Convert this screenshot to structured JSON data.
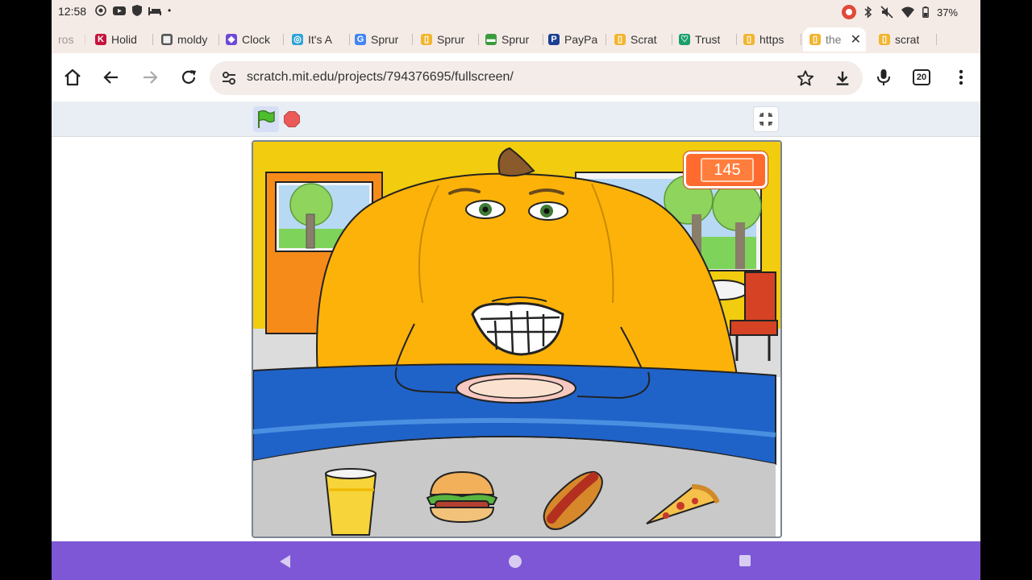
{
  "status": {
    "time": "12:58",
    "battery": "37%"
  },
  "tabs": [
    {
      "label": "ros",
      "fav_color": "#ffffff",
      "fav_glyph": ""
    },
    {
      "label": "Holid",
      "fav_color": "#c4143c",
      "fav_glyph": "K"
    },
    {
      "label": "moldy",
      "fav_color": "#555555",
      "fav_glyph": "▦"
    },
    {
      "label": "Clock",
      "fav_color": "#6c4ad8",
      "fav_glyph": "◆"
    },
    {
      "label": "It's A",
      "fav_color": "#2fa4d8",
      "fav_glyph": "◎"
    },
    {
      "label": "Sprur",
      "fav_color": "#4285f4",
      "fav_glyph": "G"
    },
    {
      "label": "Sprur",
      "fav_color": "#f2b530",
      "fav_glyph": "▯"
    },
    {
      "label": "Sprur",
      "fav_color": "#3a9b3a",
      "fav_glyph": "▬"
    },
    {
      "label": "PayPa",
      "fav_color": "#1c3f94",
      "fav_glyph": "P"
    },
    {
      "label": "Scrat",
      "fav_color": "#f2b530",
      "fav_glyph": "▯"
    },
    {
      "label": "Trust",
      "fav_color": "#1a9e6c",
      "fav_glyph": "♡"
    },
    {
      "label": "https",
      "fav_color": "#f2b530",
      "fav_glyph": "▯"
    },
    {
      "label": "the",
      "fav_color": "#f2b530",
      "fav_glyph": "▯",
      "active": true
    },
    {
      "label": "scrat",
      "fav_color": "#f2b530",
      "fav_glyph": "▯"
    }
  ],
  "toolbar": {
    "url": "scratch.mit.edu/projects/794376695/fullscreen/",
    "tab_count": "20"
  },
  "game": {
    "score": "145"
  },
  "icons": {
    "home": "home-icon",
    "back": "back-arrow-icon",
    "forward": "forward-arrow-icon",
    "reload": "reload-icon",
    "star": "bookmark-star-icon",
    "download": "download-icon",
    "mic": "mic-icon",
    "menu": "kebab-menu-icon"
  },
  "colors": {
    "nav_bar": "#7e57d6",
    "chrome_bg": "#f5ebe6",
    "pumpkin": "#fdb209",
    "table_blue": "#1f63c9",
    "score_orange": "#ff6b2e"
  }
}
